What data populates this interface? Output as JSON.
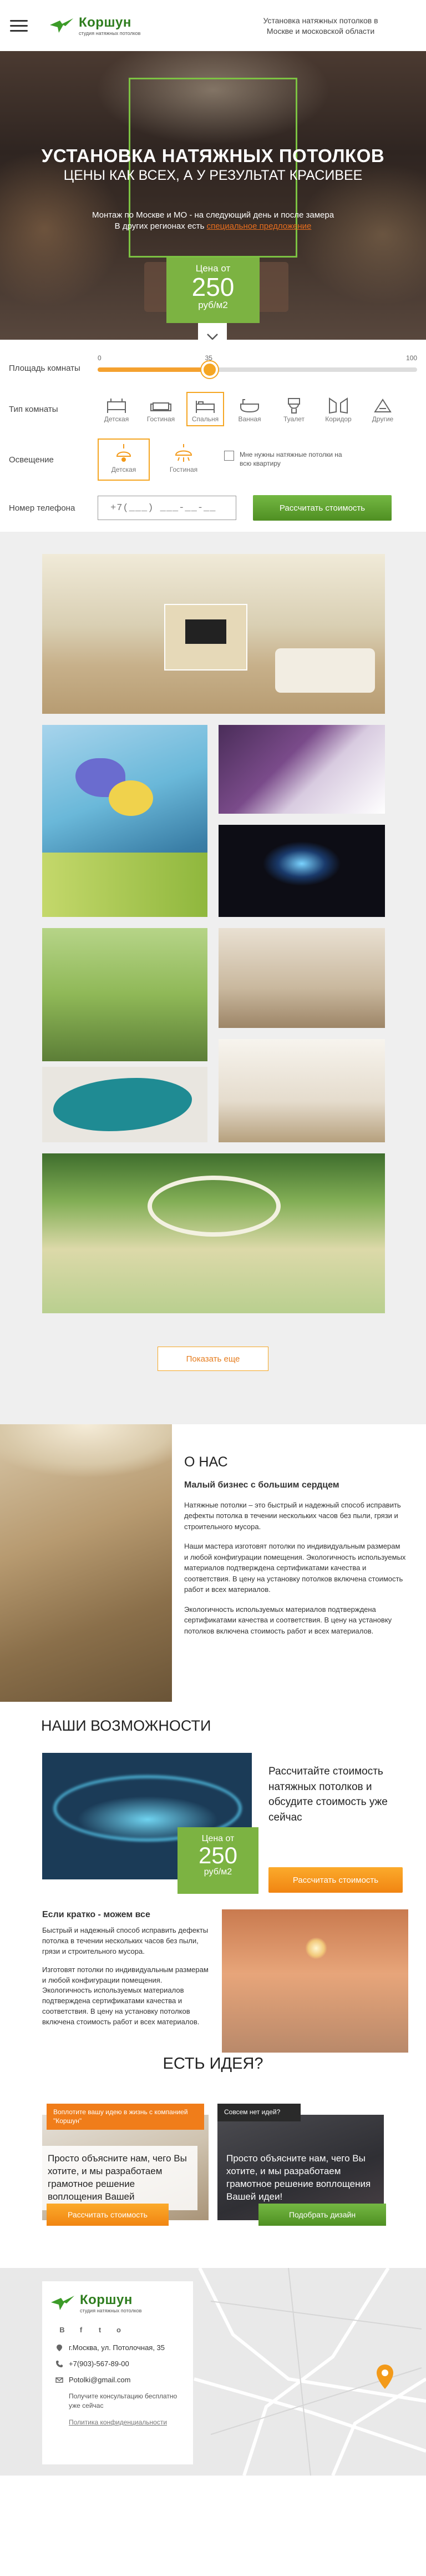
{
  "header": {
    "logo_name": "Коршун",
    "logo_sub": "студия натяжных потолков",
    "tagline": "Установка натяжных потолков в Москве и московской области"
  },
  "hero": {
    "title": "УСТАНОВКА НАТЯЖНЫХ ПОТОЛКОВ",
    "subtitle": "ЦЕНЫ КАК ВСЕХ, А У РЕЗУЛЬТАТ КРАСИВЕЕ",
    "note_line1": "Монтаж по Москве и МО - на следующий день и после замера",
    "note_line2_text": "В других регионах есть ",
    "note_line2_link": "специальное предложение",
    "price_label": "Цена от",
    "price_value": "250",
    "price_unit": "руб/м2"
  },
  "calculator": {
    "area_label": "Площадь комнаты",
    "area_min": "0",
    "area_current": "35",
    "area_max": "100",
    "area_fraction": 0.35,
    "room_type_label": "Тип комнаты",
    "room_types": [
      "Детская",
      "Гостиная",
      "Спальня",
      "Ванная",
      "Туалет",
      "Коридор",
      "Другие"
    ],
    "room_selected": "Спальня",
    "lighting_label": "Освещение",
    "lighting": [
      "Детская",
      "Гостиная"
    ],
    "lighting_selected": "Детская",
    "kitchen_check": "Мне нужны натяжные потолки на всю квартиру",
    "phone_label": "Номер телефона",
    "phone_placeholder": "+7(___) ___-__-__",
    "submit": "Рассчитать стоимость"
  },
  "gallery": {
    "more_button": "Показать еще"
  },
  "about": {
    "title": "О НАС",
    "subtitle": "Малый бизнес с большим сердцем",
    "p1": "Натяжные потолки – это быстрый и надежный способ исправить дефекты потолка в течении нескольких часов без пыли, грязи и строительного мусора.",
    "p2": "Наши мастера изготовят потолки по индивидуальным размерам и любой конфигурации помещения. Экологичность используемых материалов подтверждена сертификатами качества и соответствия. В цену на установку потолков включена стоимость работ и всех материалов.",
    "p3": "Экологичность используемых материалов подтверждена сертификатами качества и соответствия. В цену на установку потолков включена стоимость работ и всех материалов."
  },
  "features": {
    "title": "НАШИ ВОЗМОЖНОСТИ",
    "price_label": "Цена от",
    "price_value": "250",
    "price_unit": "руб/м2",
    "cta": "Рассчитайте стоимость натяжных потолков и обсудите стоимость уже сейчас",
    "cta_button": "Рассчитать стоимость",
    "text_title": "Если кратко - можем все",
    "text_p1": "Быстрый и надежный способ исправить дефекты потолка в течении нескольких часов без пыли, грязи и строительного мусора.",
    "text_p2": "Изготовят потолки по индивидуальным размерам и любой конфигурации помещения. Экологичность используемых материалов подтверждена сертификатами качества и соответствия. В цену на установку потолков включена стоимость работ и всех материалов."
  },
  "idea": {
    "title": "ЕСТЬ ИДЕЯ?",
    "left_tag": "Воплотите вашу идею в жизнь с компанией \"Коршун\"",
    "left_msg": "Просто объясните нам, чего Вы хотите, и мы разработаем грамотное решение воплощения Вашей",
    "left_button": "Рассчитать стоимость",
    "right_tag": "Совсем нет идей?",
    "right_msg": "Просто объясните нам, чего Вы хотите, и мы разработаем грамотное решение воплощения Вашей идеи!",
    "right_button": "Подобрать дизайн"
  },
  "footer": {
    "address": "г.Москва, ул. Потолочная, 35",
    "phone": "+7(903)-567-89-00",
    "email": "Potolki@gmail.com",
    "note": "Получите консультацию бесплатно уже сейчас",
    "privacy": "Политика конфиденциальности",
    "socials": [
      "B",
      "f",
      "t",
      "o"
    ]
  },
  "colors": {
    "green": "#7cb342",
    "orange": "#f18512",
    "brand": "#2e7d1e"
  }
}
